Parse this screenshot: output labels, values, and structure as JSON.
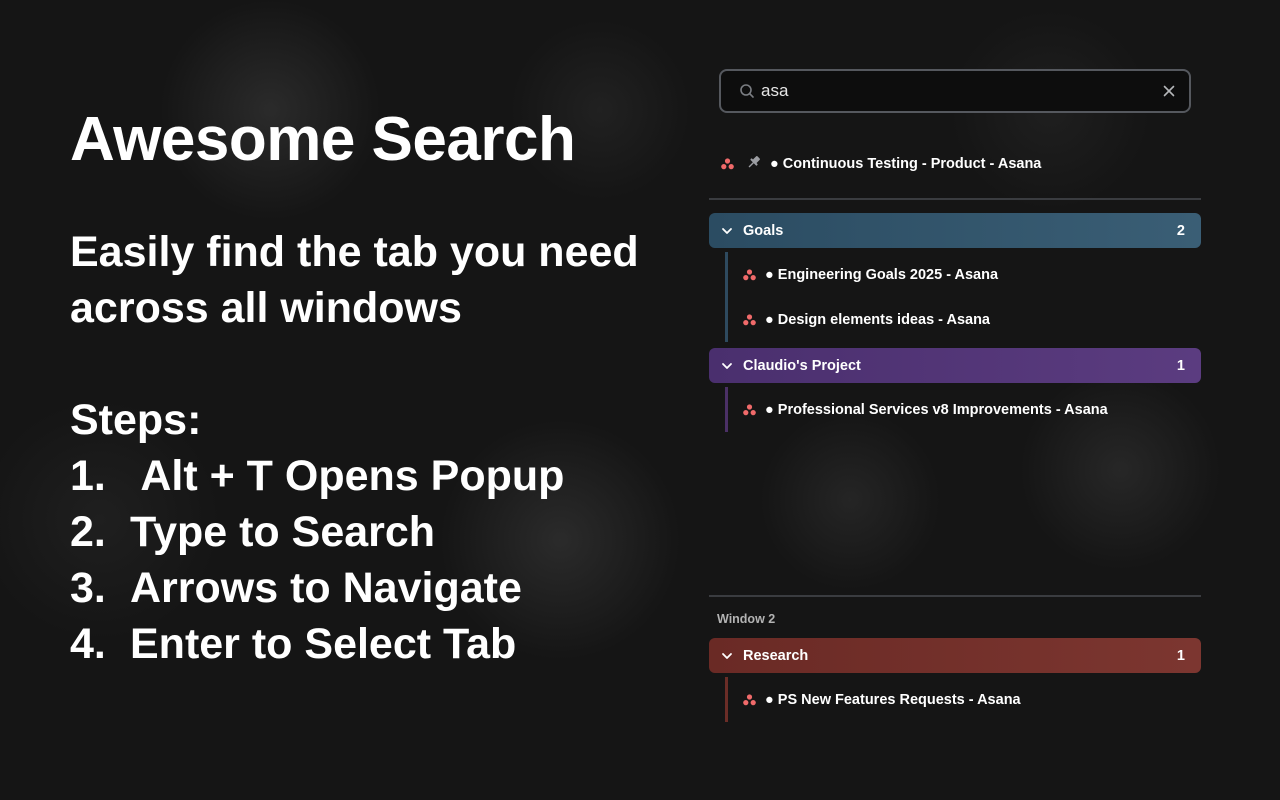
{
  "hero": {
    "title": "Awesome Search",
    "subtitle": "Easily find the tab you need across all windows",
    "steps_heading": "Steps:",
    "steps": [
      {
        "num": "1.",
        "text": " Alt + T Opens Popup"
      },
      {
        "num": "2.",
        "text": "Type to Search"
      },
      {
        "num": "3.",
        "text": "Arrows to Navigate"
      },
      {
        "num": "4.",
        "text": "Enter to Select Tab"
      }
    ]
  },
  "search": {
    "value": "asa",
    "placeholder": ""
  },
  "pinned_tab": {
    "title": "● Continuous Testing - Product - Asana",
    "icon": "asana-icon",
    "pin_icon": "pin-icon"
  },
  "window1": {
    "groups": [
      {
        "name": "Goals",
        "count": "2",
        "color": "#2b4c62",
        "tabs": [
          {
            "title": "● Engineering Goals 2025 - Asana"
          },
          {
            "title": "● Design elements ideas - Asana"
          }
        ]
      },
      {
        "name": "Claudio's Project",
        "count": "1",
        "color": "#4a2f6e",
        "tabs": [
          {
            "title": "● Professional Services v8 Improvements - Asana"
          }
        ]
      }
    ]
  },
  "window2": {
    "label": "Window 2",
    "groups": [
      {
        "name": "Research",
        "count": "1",
        "color": "#6a2a25",
        "tabs": [
          {
            "title": "● PS New Features Requests - Asana"
          }
        ]
      }
    ]
  },
  "colors": {
    "asana_icon": "#f06a6a",
    "goals_bar": "#2e4a5f",
    "claudio_bar": "#4b3066",
    "research_bar": "#6b2d27"
  }
}
